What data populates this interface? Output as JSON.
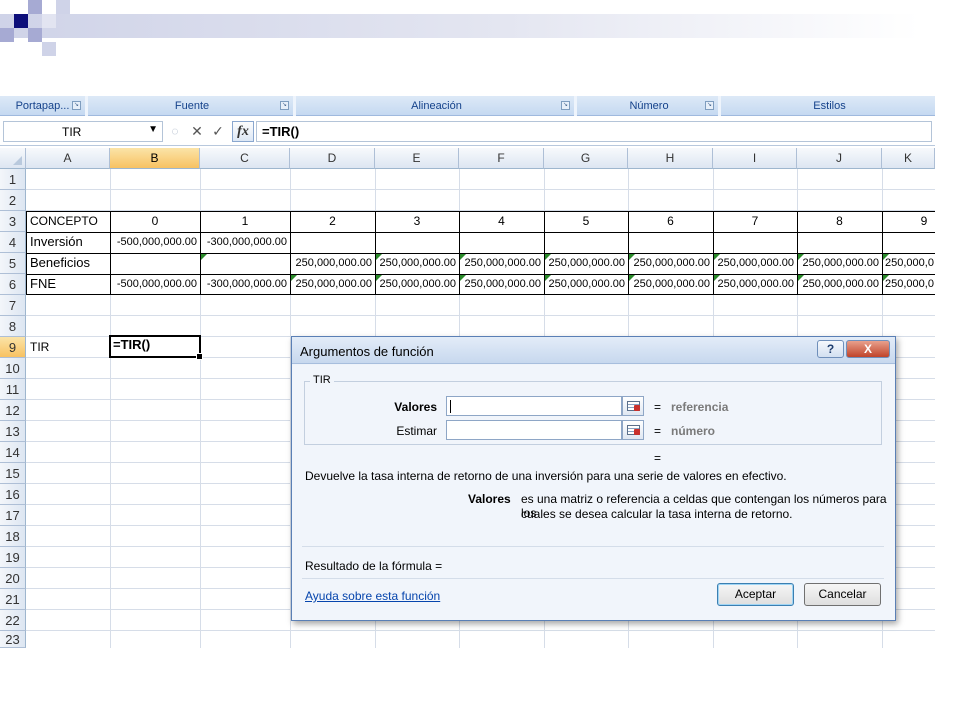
{
  "colors": {
    "ribbon_text": "#15428b",
    "accent": "#f8c262",
    "hint": "#7a7a7a",
    "link": "#0645ad"
  },
  "ribbon": {
    "groups": [
      "Portapap...",
      "Fuente",
      "Alineación",
      "Número",
      "Estilos"
    ]
  },
  "formula_bar": {
    "name_box": "TIR",
    "fx_label": "fx",
    "formula": "=TIR()"
  },
  "sheet": {
    "columns": [
      "A",
      "B",
      "C",
      "D",
      "E",
      "F",
      "G",
      "H",
      "I",
      "J",
      "K"
    ],
    "rows": [
      "1",
      "2",
      "3",
      "4",
      "5",
      "6",
      "7",
      "8",
      "9",
      "10",
      "11",
      "12",
      "13",
      "14",
      "15",
      "16",
      "17",
      "18",
      "19",
      "20",
      "21",
      "22",
      "23"
    ],
    "row3": [
      "CONCEPTO",
      "0",
      "1",
      "2",
      "3",
      "4",
      "5",
      "6",
      "7",
      "8",
      "9"
    ],
    "row4": [
      "Inversión",
      "-500,000,000.00",
      "-300,000,000.00",
      "",
      "",
      "",
      "",
      "",
      "",
      "",
      ""
    ],
    "row5": [
      "Beneficios",
      "",
      "",
      "250,000,000.00",
      "250,000,000.00",
      "250,000,000.00",
      "250,000,000.00",
      "250,000,000.00",
      "250,000,000.00",
      "250,000,000.00",
      "250,000,0"
    ],
    "row6": [
      "FNE",
      "-500,000,000.00",
      "-300,000,000.00",
      "250,000,000.00",
      "250,000,000.00",
      "250,000,000.00",
      "250,000,000.00",
      "250,000,000.00",
      "250,000,000.00",
      "250,000,000.00",
      "250,000,0"
    ],
    "row9_label": "TIR",
    "active_cell": "=TIR()"
  },
  "dialog": {
    "title": "Argumentos de función",
    "help_symbol": "?",
    "close_symbol": "X",
    "function_name": "TIR",
    "arg1_label": "Valores",
    "arg1_hint": "referencia",
    "arg2_label": "Estimar",
    "arg2_hint": "número",
    "equals": "=",
    "description": "Devuelve la tasa interna de retorno de una inversión para una serie de valores en efectivo.",
    "param_name": "Valores",
    "param_desc_1": "es una matriz o referencia a celdas que contengan los números para los",
    "param_desc_2": "cuales se desea calcular la tasa interna de retorno.",
    "result_label": "Resultado de la fórmula =",
    "help_link": "Ayuda sobre esta función",
    "ok": "Aceptar",
    "cancel": "Cancelar"
  }
}
